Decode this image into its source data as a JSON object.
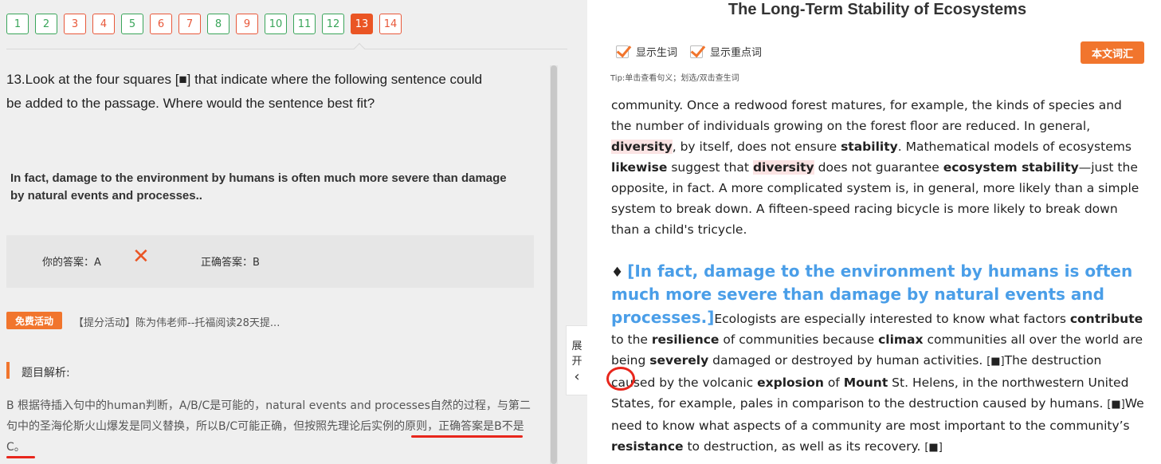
{
  "question_numbers": [
    {
      "num": "1",
      "status": "ok"
    },
    {
      "num": "2",
      "status": "ok"
    },
    {
      "num": "3",
      "status": "bad"
    },
    {
      "num": "4",
      "status": "bad"
    },
    {
      "num": "5",
      "status": "ok"
    },
    {
      "num": "6",
      "status": "bad"
    },
    {
      "num": "7",
      "status": "bad"
    },
    {
      "num": "8",
      "status": "ok"
    },
    {
      "num": "9",
      "status": "bad"
    },
    {
      "num": "10",
      "status": "ok"
    },
    {
      "num": "11",
      "status": "ok"
    },
    {
      "num": "12",
      "status": "ok"
    },
    {
      "num": "13",
      "status": "cur"
    },
    {
      "num": "14",
      "status": "bad"
    }
  ],
  "question": {
    "text": "13.Look at the four squares [■] that indicate where the following sentence could be added to the passage. Where would the sentence best fit?",
    "insert_sentence": "In fact, damage to the environment by humans is often much more severe than damage by natural events and processes..",
    "your_answer": "你的答案：A",
    "correct_answer": "正确答案：B",
    "wrong_mark": "✕"
  },
  "promo": {
    "badge": "免费活动",
    "text": "【提分活动】陈为伟老师--托福阅读28天提..."
  },
  "analysis": {
    "title": "题目解析:",
    "body": "B 根据待插入句中的human判断，A/B/C是可能的，natural events and processes自然的过程，与第二句中的圣海伦斯火山爆发是同义替换，所以B/C可能正确，但按照先理论后实例的原则，正确答案是B不是C。"
  },
  "expand": {
    "line1": "展",
    "line2": "开",
    "arrow": "‹"
  },
  "passage_title": "The Long-Term Stability of Ecosystems",
  "toolbar": {
    "show_new_words": "显示生词",
    "show_key_words": "显示重点词",
    "vocab_button": "本文词汇",
    "tip": "Tip:单击查看句义；划选/双击查生词"
  },
  "colors": {
    "accent": "#f1752d",
    "correct": "#3aa55a",
    "wrong": "#e8583a",
    "insert": "#4a9ee8"
  }
}
